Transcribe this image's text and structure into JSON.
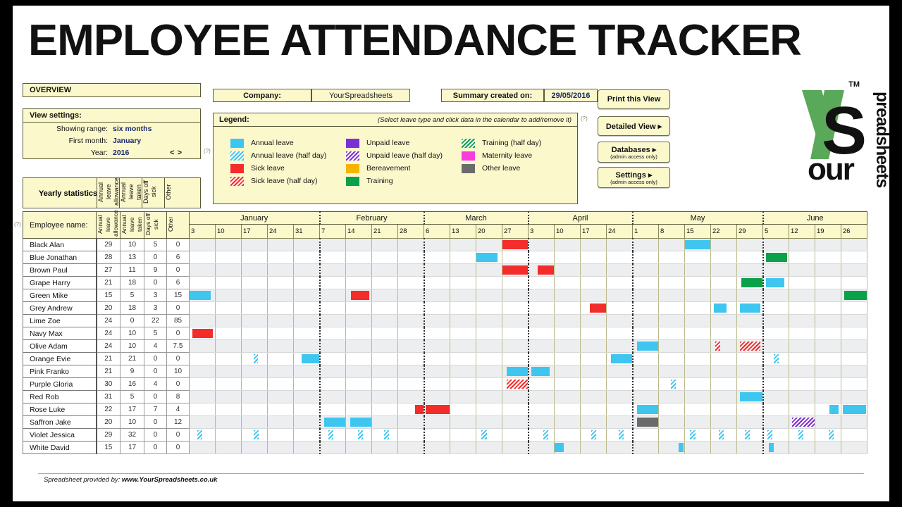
{
  "title": "EMPLOYEE ATTENDANCE TRACKER",
  "overview": {
    "label": "OVERVIEW"
  },
  "view_settings": {
    "header": "View settings:",
    "rows": [
      {
        "key": "Showing range:",
        "value": "six months"
      },
      {
        "key": "First month:",
        "value": "January"
      },
      {
        "key": "Year:",
        "value": "2016"
      }
    ],
    "prev_label": "<",
    "next_label": ">",
    "help_marker": "(?)"
  },
  "company": {
    "label": "Company:",
    "value": "YourSpreadsheets"
  },
  "summary": {
    "label": "Summary created on:",
    "value": "29/05/2016",
    "help_marker": "(?)"
  },
  "legend": {
    "header": "Legend:",
    "hint": "(Select leave type and click data in the calendar to add/remove it)",
    "help_marker": "(?)",
    "columns": [
      [
        {
          "label": "Annual leave",
          "color": "#3ec6f0",
          "pattern": "solid"
        },
        {
          "label": "Annual leave (half day)",
          "color": "#3ec6f0",
          "pattern": "hatch"
        },
        {
          "label": "Sick leave",
          "color": "#f32c2c",
          "pattern": "solid"
        },
        {
          "label": "Sick leave (half day)",
          "color": "#f32c2c",
          "pattern": "hatch"
        }
      ],
      [
        {
          "label": "Unpaid leave",
          "color": "#7d2fd6",
          "pattern": "solid"
        },
        {
          "label": "Unpaid leave (half day)",
          "color": "#7d2fd6",
          "pattern": "hatch"
        },
        {
          "label": "Bereavement",
          "color": "#f7b400",
          "pattern": "solid"
        },
        {
          "label": "Training",
          "color": "#0aa14b",
          "pattern": "solid"
        }
      ],
      [
        {
          "label": "Training (half day)",
          "color": "#0aa14b",
          "pattern": "hatch"
        },
        {
          "label": "Maternity leave",
          "color": "#f93ce0",
          "pattern": "solid"
        },
        {
          "label": "Other leave",
          "color": "#6b6b6b",
          "pattern": "solid"
        }
      ]
    ]
  },
  "buttons": [
    {
      "line1": "Print this View",
      "line2": ""
    },
    {
      "line1": "Detailed View ▸",
      "line2": ""
    },
    {
      "line1": "Databases ▸",
      "line2": "(admin access only)"
    },
    {
      "line1": "Settings ▸",
      "line2": "(admin access only)"
    }
  ],
  "logo": {
    "tm": "TM",
    "word_our": "our",
    "word_vertical": "preadsheets"
  },
  "stats_header": {
    "title": "Yearly statistics:"
  },
  "table": {
    "name_header": "Employee name:",
    "stat_headers": [
      "Annual leave\nallowance",
      "Annual leave\ntaken",
      "Days off sick",
      "Other"
    ],
    "rows": [
      {
        "name": "Black Alan",
        "allowance": "29",
        "taken": "10",
        "sick": "5",
        "other": "0"
      },
      {
        "name": "Blue Jonathan",
        "allowance": "28",
        "taken": "13",
        "sick": "0",
        "other": "6"
      },
      {
        "name": "Brown Paul",
        "allowance": "27",
        "taken": "11",
        "sick": "9",
        "other": "0"
      },
      {
        "name": "Grape Harry",
        "allowance": "21",
        "taken": "18",
        "sick": "0",
        "other": "6"
      },
      {
        "name": "Green Mike",
        "allowance": "15",
        "taken": "5",
        "sick": "3",
        "other": "15"
      },
      {
        "name": "Grey Andrew",
        "allowance": "20",
        "taken": "18",
        "sick": "3",
        "other": "0"
      },
      {
        "name": "Lime Zoe",
        "allowance": "24",
        "taken": "0",
        "sick": "22",
        "other": "85"
      },
      {
        "name": "Navy Max",
        "allowance": "24",
        "taken": "10",
        "sick": "5",
        "other": "0"
      },
      {
        "name": "Olive Adam",
        "allowance": "24",
        "taken": "10",
        "sick": "4",
        "other": "7.5"
      },
      {
        "name": "Orange Evie",
        "allowance": "21",
        "taken": "21",
        "sick": "0",
        "other": "0"
      },
      {
        "name": "Pink Franko",
        "allowance": "21",
        "taken": "9",
        "sick": "0",
        "other": "10"
      },
      {
        "name": "Purple Gloria",
        "allowance": "30",
        "taken": "16",
        "sick": "4",
        "other": "0"
      },
      {
        "name": "Red Rob",
        "allowance": "31",
        "taken": "5",
        "sick": "0",
        "other": "8"
      },
      {
        "name": "Rose Luke",
        "allowance": "22",
        "taken": "17",
        "sick": "7",
        "other": "4"
      },
      {
        "name": "Saffron Jake",
        "allowance": "20",
        "taken": "10",
        "sick": "0",
        "other": "12"
      },
      {
        "name": "Violet Jessica",
        "allowance": "29",
        "taken": "32",
        "sick": "0",
        "other": "0"
      },
      {
        "name": "White David",
        "allowance": "15",
        "taken": "17",
        "sick": "0",
        "other": "0"
      }
    ]
  },
  "calendar": {
    "months": [
      {
        "name": "January",
        "weeks": [
          "3",
          "10",
          "17",
          "24",
          "31"
        ]
      },
      {
        "name": "February",
        "weeks": [
          "7",
          "14",
          "21",
          "28"
        ]
      },
      {
        "name": "March",
        "weeks": [
          "6",
          "13",
          "20",
          "27"
        ]
      },
      {
        "name": "April",
        "weeks": [
          "3",
          "10",
          "17",
          "24"
        ]
      },
      {
        "name": "May",
        "weeks": [
          "1",
          "8",
          "15",
          "22",
          "29"
        ]
      },
      {
        "name": "June",
        "weeks": [
          "5",
          "12",
          "19",
          "26"
        ]
      }
    ],
    "colors": {
      "annual": "#3ec6f0",
      "sick": "#f32c2c",
      "unpaid": "#7d2fd6",
      "bereavement": "#f7b400",
      "training": "#0aa14b",
      "maternity": "#f93ce0",
      "other": "#6b6b6b"
    },
    "events": [
      {
        "row": 0,
        "col": 12,
        "span": 1,
        "offset": 0,
        "type": "sick",
        "half": false
      },
      {
        "row": 0,
        "col": 19,
        "span": 1,
        "offset": 0,
        "type": "annual",
        "half": false
      },
      {
        "row": 1,
        "col": 11,
        "span": 0.8,
        "offset": 0,
        "type": "annual",
        "half": false
      },
      {
        "row": 1,
        "col": 22,
        "span": 0.8,
        "offset": 0.1,
        "type": "training",
        "half": false
      },
      {
        "row": 2,
        "col": 12,
        "span": 1.2,
        "offset": 0,
        "type": "sick",
        "half": false
      },
      {
        "row": 2,
        "col": 13,
        "span": 1,
        "offset": 0.35,
        "type": "sick",
        "half": false
      },
      {
        "row": 3,
        "col": 21,
        "span": 0.9,
        "offset": 0.15,
        "type": "training",
        "half": false
      },
      {
        "row": 3,
        "col": 22,
        "span": 0.7,
        "offset": 0.1,
        "type": "annual",
        "half": false
      },
      {
        "row": 4,
        "col": 0,
        "span": 0.8,
        "offset": 0,
        "type": "annual",
        "half": false
      },
      {
        "row": 4,
        "col": 6,
        "span": 0.7,
        "offset": 0.2,
        "type": "sick",
        "half": false
      },
      {
        "row": 4,
        "col": 25,
        "span": 0.9,
        "offset": 0.1,
        "type": "training",
        "half": false
      },
      {
        "row": 5,
        "col": 15,
        "span": 0.7,
        "offset": 0.35,
        "type": "sick",
        "half": false
      },
      {
        "row": 5,
        "col": 20,
        "span": 0.5,
        "offset": 0.1,
        "type": "annual",
        "half": false
      },
      {
        "row": 5,
        "col": 21,
        "span": 0.8,
        "offset": 0.1,
        "type": "annual",
        "half": false
      },
      {
        "row": 7,
        "col": 0,
        "span": 0.8,
        "offset": 0.1,
        "type": "sick",
        "half": false
      },
      {
        "row": 8,
        "col": 17,
        "span": 0.9,
        "offset": 0.15,
        "type": "annual",
        "half": false
      },
      {
        "row": 8,
        "col": 20,
        "span": 0.2,
        "offset": 0.15,
        "type": "sick",
        "half": true
      },
      {
        "row": 8,
        "col": 21,
        "span": 0.8,
        "offset": 0.1,
        "type": "sick",
        "half": true
      },
      {
        "row": 9,
        "col": 2,
        "span": 0.18,
        "offset": 0.45,
        "type": "annual",
        "half": true
      },
      {
        "row": 9,
        "col": 4,
        "span": 0.8,
        "offset": 0.3,
        "type": "annual",
        "half": false
      },
      {
        "row": 9,
        "col": 16,
        "span": 0.9,
        "offset": 0.15,
        "type": "annual",
        "half": false
      },
      {
        "row": 9,
        "col": 22,
        "span": 0.18,
        "offset": 0.4,
        "type": "annual",
        "half": true
      },
      {
        "row": 10,
        "col": 12,
        "span": 0.9,
        "offset": 0.15,
        "type": "annual",
        "half": false
      },
      {
        "row": 10,
        "col": 13,
        "span": 0.7,
        "offset": 0.1,
        "type": "annual",
        "half": false
      },
      {
        "row": 11,
        "col": 12,
        "span": 0.9,
        "offset": 0.15,
        "type": "sick",
        "half": true
      },
      {
        "row": 11,
        "col": 18,
        "span": 0.2,
        "offset": 0.45,
        "type": "annual",
        "half": true
      },
      {
        "row": 12,
        "col": 21,
        "span": 0.9,
        "offset": 0.1,
        "type": "annual",
        "half": false
      },
      {
        "row": 13,
        "col": 8,
        "span": 0.35,
        "offset": 0.65,
        "type": "sick",
        "half": false
      },
      {
        "row": 13,
        "col": 9,
        "span": 0.9,
        "offset": 0.05,
        "type": "sick",
        "half": false
      },
      {
        "row": 13,
        "col": 17,
        "span": 0.8,
        "offset": 0.15,
        "type": "annual",
        "half": false
      },
      {
        "row": 13,
        "col": 24,
        "span": 0.35,
        "offset": 0.55,
        "type": "annual",
        "half": false
      },
      {
        "row": 13,
        "col": 25,
        "span": 0.9,
        "offset": 0.05,
        "type": "annual",
        "half": false
      },
      {
        "row": 14,
        "col": 5,
        "span": 0.9,
        "offset": 0.15,
        "type": "annual",
        "half": false
      },
      {
        "row": 14,
        "col": 6,
        "span": 0.9,
        "offset": 0.15,
        "type": "annual",
        "half": false
      },
      {
        "row": 14,
        "col": 17,
        "span": 0.8,
        "offset": 0.15,
        "type": "other",
        "half": false
      },
      {
        "row": 14,
        "col": 23,
        "span": 0.9,
        "offset": 0.1,
        "type": "unpaid",
        "half": true
      },
      {
        "row": 15,
        "col": 0,
        "span": 0.2,
        "offset": 0.3,
        "type": "annual",
        "half": true
      },
      {
        "row": 15,
        "col": 2,
        "span": 0.2,
        "offset": 0.45,
        "type": "annual",
        "half": true
      },
      {
        "row": 15,
        "col": 5,
        "span": 0.2,
        "offset": 0.3,
        "type": "annual",
        "half": true
      },
      {
        "row": 15,
        "col": 6,
        "span": 0.2,
        "offset": 0.45,
        "type": "annual",
        "half": true
      },
      {
        "row": 15,
        "col": 7,
        "span": 0.2,
        "offset": 0.45,
        "type": "annual",
        "half": true
      },
      {
        "row": 15,
        "col": 11,
        "span": 0.2,
        "offset": 0.2,
        "type": "annual",
        "half": true
      },
      {
        "row": 15,
        "col": 13,
        "span": 0.2,
        "offset": 0.55,
        "type": "annual",
        "half": true
      },
      {
        "row": 15,
        "col": 15,
        "span": 0.2,
        "offset": 0.4,
        "type": "annual",
        "half": true
      },
      {
        "row": 15,
        "col": 16,
        "span": 0.2,
        "offset": 0.45,
        "type": "annual",
        "half": true
      },
      {
        "row": 15,
        "col": 19,
        "span": 0.2,
        "offset": 0.2,
        "type": "annual",
        "half": true
      },
      {
        "row": 15,
        "col": 20,
        "span": 0.2,
        "offset": 0.3,
        "type": "annual",
        "half": true
      },
      {
        "row": 15,
        "col": 21,
        "span": 0.2,
        "offset": 0.3,
        "type": "annual",
        "half": true
      },
      {
        "row": 15,
        "col": 22,
        "span": 0.2,
        "offset": 0.15,
        "type": "annual",
        "half": true
      },
      {
        "row": 15,
        "col": 23,
        "span": 0.2,
        "offset": 0.35,
        "type": "annual",
        "half": true
      },
      {
        "row": 15,
        "col": 24,
        "span": 0.2,
        "offset": 0.5,
        "type": "annual",
        "half": true
      },
      {
        "row": 16,
        "col": 14,
        "span": 0.35,
        "offset": 0.0,
        "type": "annual",
        "half": false
      },
      {
        "row": 16,
        "col": 18,
        "span": 0.2,
        "offset": 0.75,
        "type": "annual",
        "half": false
      },
      {
        "row": 16,
        "col": 22,
        "span": 0.2,
        "offset": 0.2,
        "type": "annual",
        "half": false
      }
    ]
  },
  "footer": {
    "prefix": "Spreadsheet provided by:",
    "site": "www.YourSpreadsheets.co.uk"
  }
}
